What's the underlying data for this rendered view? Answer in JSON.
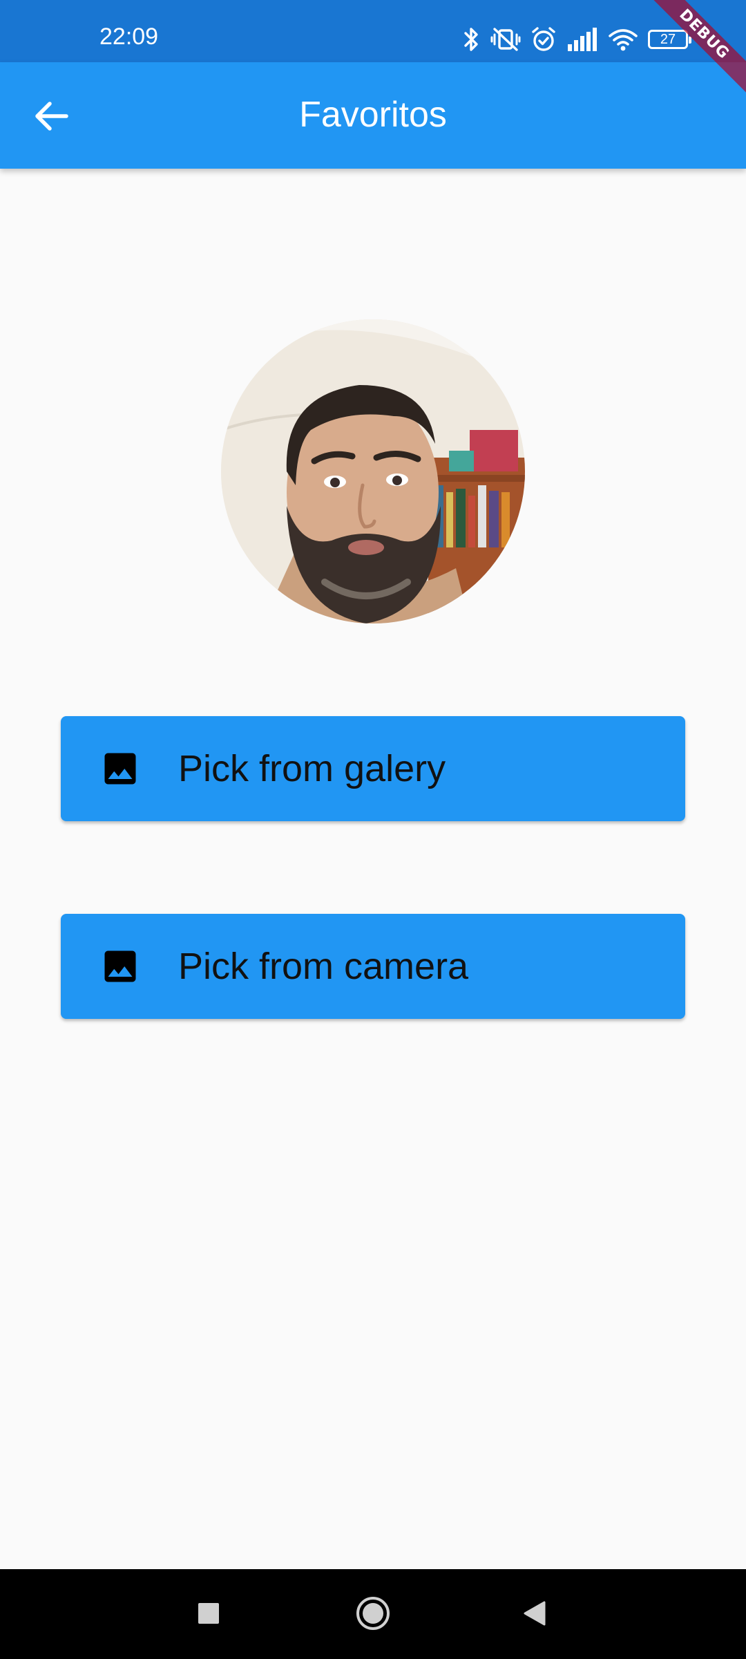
{
  "status_bar": {
    "time": "22:09",
    "battery_level": "27",
    "icons": [
      "bluetooth-icon",
      "vibrate-off-icon",
      "alarm-icon",
      "signal-icon",
      "wifi-icon",
      "battery-icon"
    ]
  },
  "debug_banner": "DEBUG",
  "app_bar": {
    "title": "Favoritos",
    "back_icon": "arrow-back-icon"
  },
  "avatar": {
    "icon": "profile-photo"
  },
  "buttons": {
    "galery": {
      "label": "Pick from galery",
      "icon": "image-icon"
    },
    "camera": {
      "label": "Pick from camera",
      "icon": "image-icon"
    }
  },
  "nav_bar": {
    "icons": [
      "recents-square-icon",
      "home-circle-icon",
      "back-triangle-icon"
    ]
  },
  "colors": {
    "status_bar": "#1976d2",
    "app_bar": "#2196f3",
    "button": "#2196f3",
    "background": "#fafafa",
    "nav_bar": "#000000"
  }
}
